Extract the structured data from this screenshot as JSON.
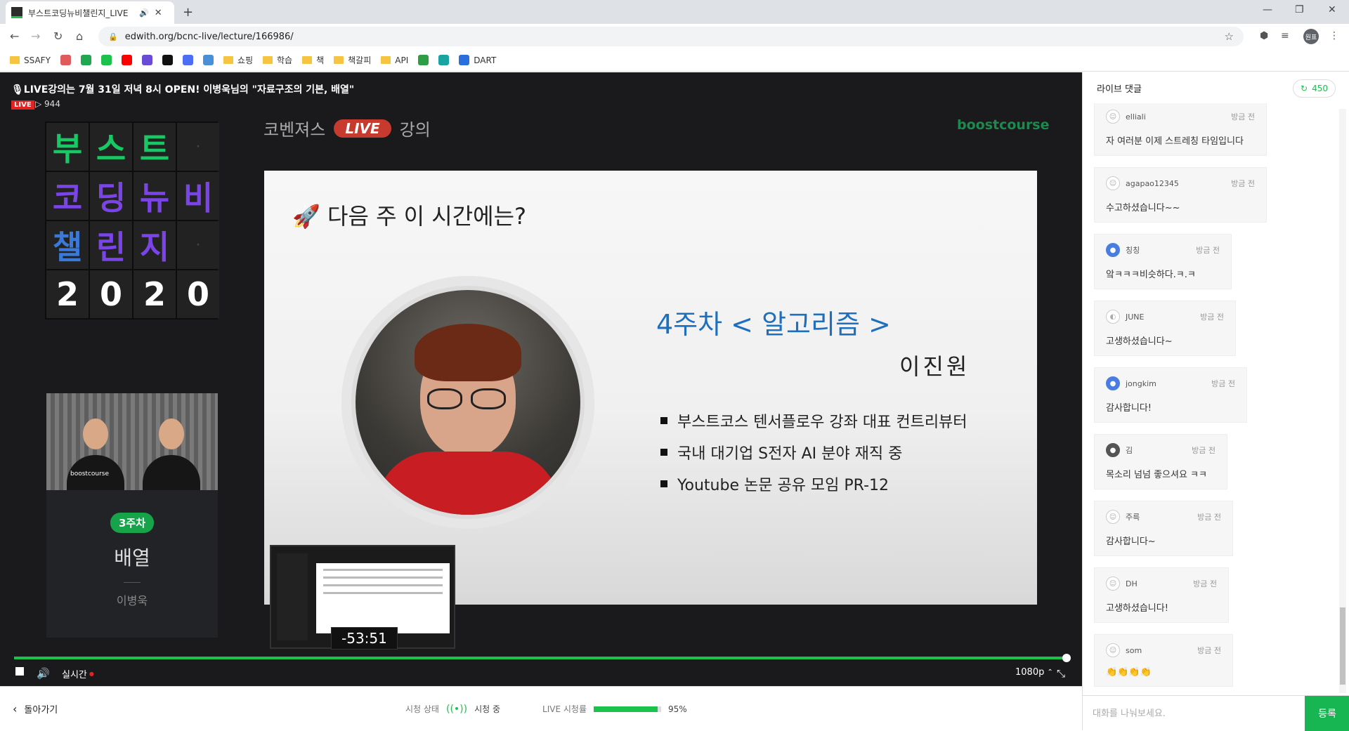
{
  "browser": {
    "tab_title": "부스트코딩뉴비챌린지_LIVE",
    "url": "edwith.org/bcnc-live/lecture/166986/",
    "profile_initials": "원표",
    "bookmarks": [
      {
        "label": "SSAFY",
        "icon": "folder"
      },
      {
        "label": "",
        "icon": "pencil-icon"
      },
      {
        "label": "",
        "icon": "green-app-icon"
      },
      {
        "label": "",
        "icon": "chevron-icon"
      },
      {
        "label": "",
        "icon": "youtube-icon"
      },
      {
        "label": "",
        "icon": "purple-app-icon"
      },
      {
        "label": "",
        "icon": "x-app-icon"
      },
      {
        "label": "",
        "icon": "blue-app-icon"
      },
      {
        "label": "",
        "icon": "doc-icon"
      },
      {
        "label": "쇼핑",
        "icon": "folder"
      },
      {
        "label": "학습",
        "icon": "folder"
      },
      {
        "label": "책",
        "icon": "folder"
      },
      {
        "label": "책갈피",
        "icon": "folder"
      },
      {
        "label": "API",
        "icon": "folder"
      },
      {
        "label": "",
        "icon": "green-leaf-icon"
      },
      {
        "label": "",
        "icon": "refresh-app-icon"
      },
      {
        "label": "DART",
        "icon": "dart-icon"
      }
    ]
  },
  "player": {
    "title": "🎙LIVE강의는 7월 31일 저녁 8시 OPEN! 이병욱님의 \"자료구조의 기본, 배열\"",
    "live_label": "LIVE",
    "viewer_count": "▷ 944",
    "board_letters": [
      "부",
      "스",
      "트",
      "·",
      "코",
      "딩",
      "뉴",
      "비",
      "챌",
      "린",
      "지",
      "·",
      "2",
      "0",
      "2",
      "0"
    ],
    "week_badge": "3주차",
    "week_topic": "배열",
    "week_teacher": "이병욱",
    "header_left": "코벤져스",
    "header_live": "LIVE",
    "header_right": "강의",
    "brand": "boostcourse",
    "slide": {
      "title": "🚀 다음 주 이 시간에는?",
      "course": "4주차 < 알고리즘 >",
      "instructor": "이진원",
      "bullets": [
        "부스트코스 텐서플로우 강좌 대표 컨트리뷰터",
        "국내 대기업 S전자 AI 분야 재직 중",
        "Youtube 논문 공유 모임 PR-12"
      ]
    },
    "seek_preview_time": "-53:51",
    "progress_fraction": 1.0,
    "realtime_label": "실시간",
    "quality": "1080p"
  },
  "bottom": {
    "back_label": "돌아가기",
    "watch_status_label": "시청 상태",
    "watch_status_value": "시청 중",
    "live_rate_label": "LIVE 시청률",
    "live_rate_value": "95%",
    "live_rate_fraction": 0.95
  },
  "chat": {
    "title": "라이브 댓글",
    "count": "450",
    "messages": [
      {
        "user": "elliali",
        "time": "방금 전",
        "text": "자 여러분 이제 스트레칭 타임입니다",
        "avatar": "smiley"
      },
      {
        "user": "agapao12345",
        "time": "방금 전",
        "text": "수고하셨습니다~~",
        "avatar": "smiley"
      },
      {
        "user": "칭칭",
        "time": "방금 전",
        "text": "앜ㅋㅋㅋ비슷하다.ㅋ.ㅋ",
        "avatar": "blue"
      },
      {
        "user": "JUNE",
        "time": "방금 전",
        "text": "고생하셨습니다~",
        "avatar": "photo"
      },
      {
        "user": "jongkim",
        "time": "방금 전",
        "text": "감사합니다!",
        "avatar": "blue"
      },
      {
        "user": "김",
        "time": "방금 전",
        "text": "목소리 넘넘 좋으셔요 ㅋㅋ",
        "avatar": "dark"
      },
      {
        "user": "주륵",
        "time": "방금 전",
        "text": "감사합니다~",
        "avatar": "smiley"
      },
      {
        "user": "DH",
        "time": "방금 전",
        "text": "고생하셨습니다!",
        "avatar": "smiley"
      },
      {
        "user": "som",
        "time": "방금 전",
        "text": "👏👏👏👏",
        "avatar": "smiley"
      }
    ],
    "input_placeholder": "대화를 나눠보세요.",
    "send_label": "등록"
  }
}
